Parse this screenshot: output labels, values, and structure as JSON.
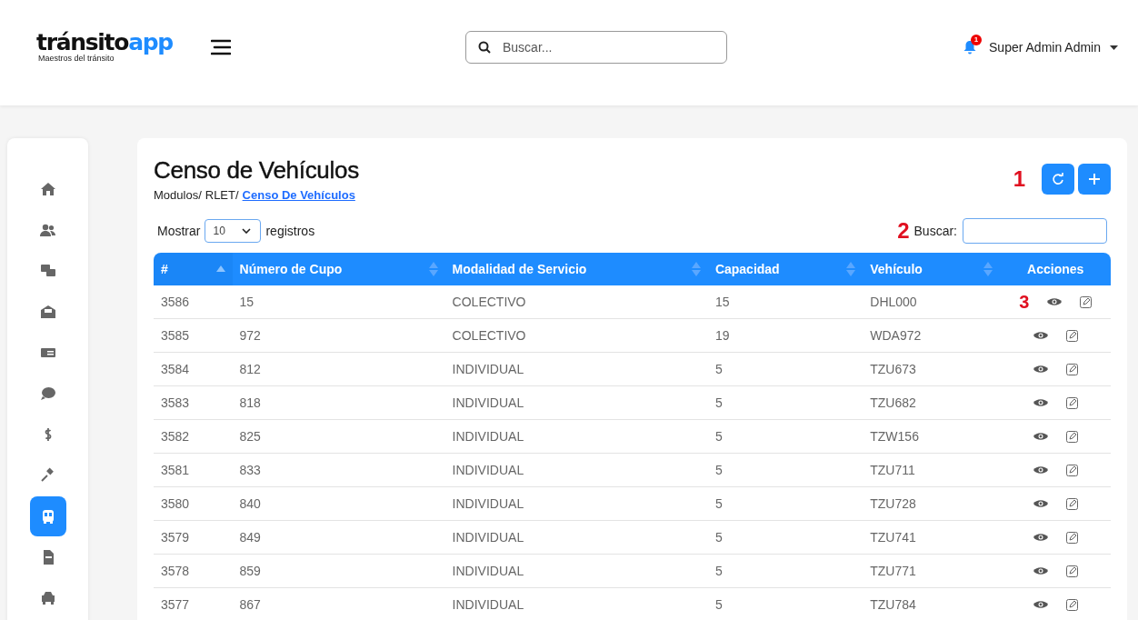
{
  "brand": {
    "name_dark": "tránsito",
    "name_accent": "app",
    "tagline": "Maestros del tránsito"
  },
  "search": {
    "placeholder": "Buscar..."
  },
  "notifications": {
    "count": "1"
  },
  "user": {
    "name": "Super Admin Admin"
  },
  "sidebar": {
    "items": [
      {
        "selected": false
      },
      {
        "selected": false
      },
      {
        "selected": false
      },
      {
        "selected": false
      },
      {
        "selected": false
      },
      {
        "selected": false
      },
      {
        "selected": false
      },
      {
        "selected": false
      },
      {
        "selected": true
      },
      {
        "selected": false
      },
      {
        "selected": false
      }
    ]
  },
  "page": {
    "title": "Censo de Vehículos",
    "breadcrumb": [
      "Modulos/",
      "RLET/"
    ],
    "breadcrumb_current": "Censo De Vehículos"
  },
  "callouts": [
    "1",
    "2",
    "3"
  ],
  "length_menu": {
    "before": "Mostrar",
    "value": "10",
    "after": "registros"
  },
  "filter": {
    "label": "Buscar:"
  },
  "table": {
    "columns": [
      {
        "label": "#",
        "sortable": true,
        "sorted": true
      },
      {
        "label": "Número de Cupo",
        "sortable": true,
        "sorted": false
      },
      {
        "label": "Modalidad de Servicio",
        "sortable": true,
        "sorted": false
      },
      {
        "label": "Capacidad",
        "sortable": true,
        "sorted": false
      },
      {
        "label": "Vehículo",
        "sortable": true,
        "sorted": false
      },
      {
        "label": "Acciones",
        "sortable": false
      }
    ],
    "rows": [
      [
        "3586",
        "15",
        "COLECTIVO",
        "15",
        "DHL000"
      ],
      [
        "3585",
        "972",
        "COLECTIVO",
        "19",
        "WDA972"
      ],
      [
        "3584",
        "812",
        "INDIVIDUAL",
        "5",
        "TZU673"
      ],
      [
        "3583",
        "818",
        "INDIVIDUAL",
        "5",
        "TZU682"
      ],
      [
        "3582",
        "825",
        "INDIVIDUAL",
        "5",
        "TZW156"
      ],
      [
        "3581",
        "833",
        "INDIVIDUAL",
        "5",
        "TZU711"
      ],
      [
        "3580",
        "840",
        "INDIVIDUAL",
        "5",
        "TZU728"
      ],
      [
        "3579",
        "849",
        "INDIVIDUAL",
        "5",
        "TZU741"
      ],
      [
        "3578",
        "859",
        "INDIVIDUAL",
        "5",
        "TZU771"
      ],
      [
        "3577",
        "867",
        "INDIVIDUAL",
        "5",
        "TZU784"
      ]
    ]
  }
}
